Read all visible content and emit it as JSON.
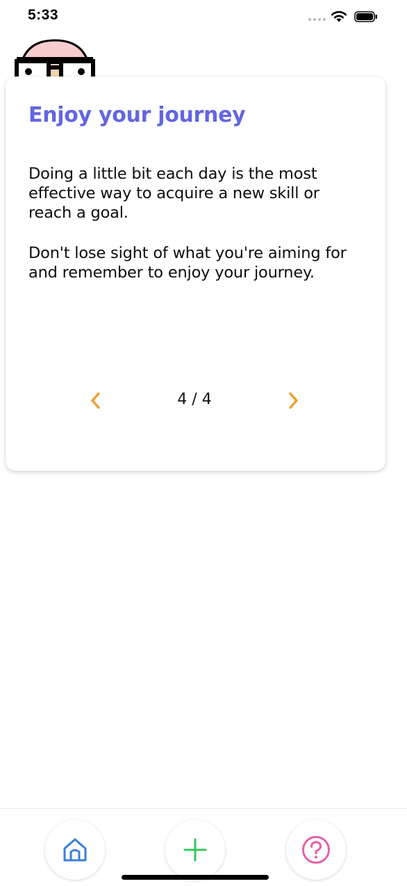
{
  "status_bar": {
    "time": "5:33"
  },
  "card": {
    "title": "Enjoy your journey",
    "paragraphs": [
      "Doing a little bit each day is the most effective way to acquire a new skill or reach a goal.",
      "Don't lose sight of what you're aiming for and remember to enjoy your journey."
    ],
    "pager": {
      "label": "4 / 4",
      "current": 4,
      "total": 4,
      "prev_icon": "chevron-left-icon",
      "next_icon": "chevron-right-icon"
    }
  },
  "tab_bar": {
    "items": [
      {
        "icon": "home-icon",
        "color": "#3b7dd8"
      },
      {
        "icon": "plus-icon",
        "color": "#34c759"
      },
      {
        "icon": "question-icon",
        "color": "#e85fa6"
      }
    ]
  },
  "colors": {
    "title_accent": "#6366e0",
    "pager_arrow": "#f0a030"
  }
}
